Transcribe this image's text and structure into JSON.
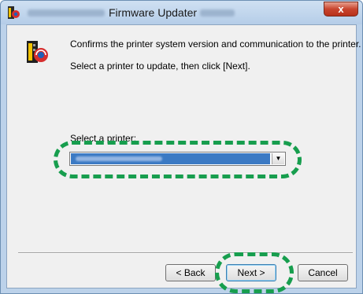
{
  "window": {
    "title": "Firmware Updater",
    "close_glyph": "x"
  },
  "messages": {
    "line1": "Confirms the printer system version and communication to the printer.",
    "line2": "Select a printer to update, then click [Next]."
  },
  "printer_select": {
    "label": "Select a printer:",
    "arrow_glyph": "▼"
  },
  "buttons": {
    "back": "< Back",
    "next": "Next >",
    "cancel": "Cancel"
  },
  "icons": {
    "app": "printer-app-icon",
    "header": "printer-update-icon",
    "dropdown": "chevron-down-icon"
  },
  "colors": {
    "highlight": "#179e4e",
    "selection": "#3b7ac4",
    "close": "#c8452e"
  }
}
